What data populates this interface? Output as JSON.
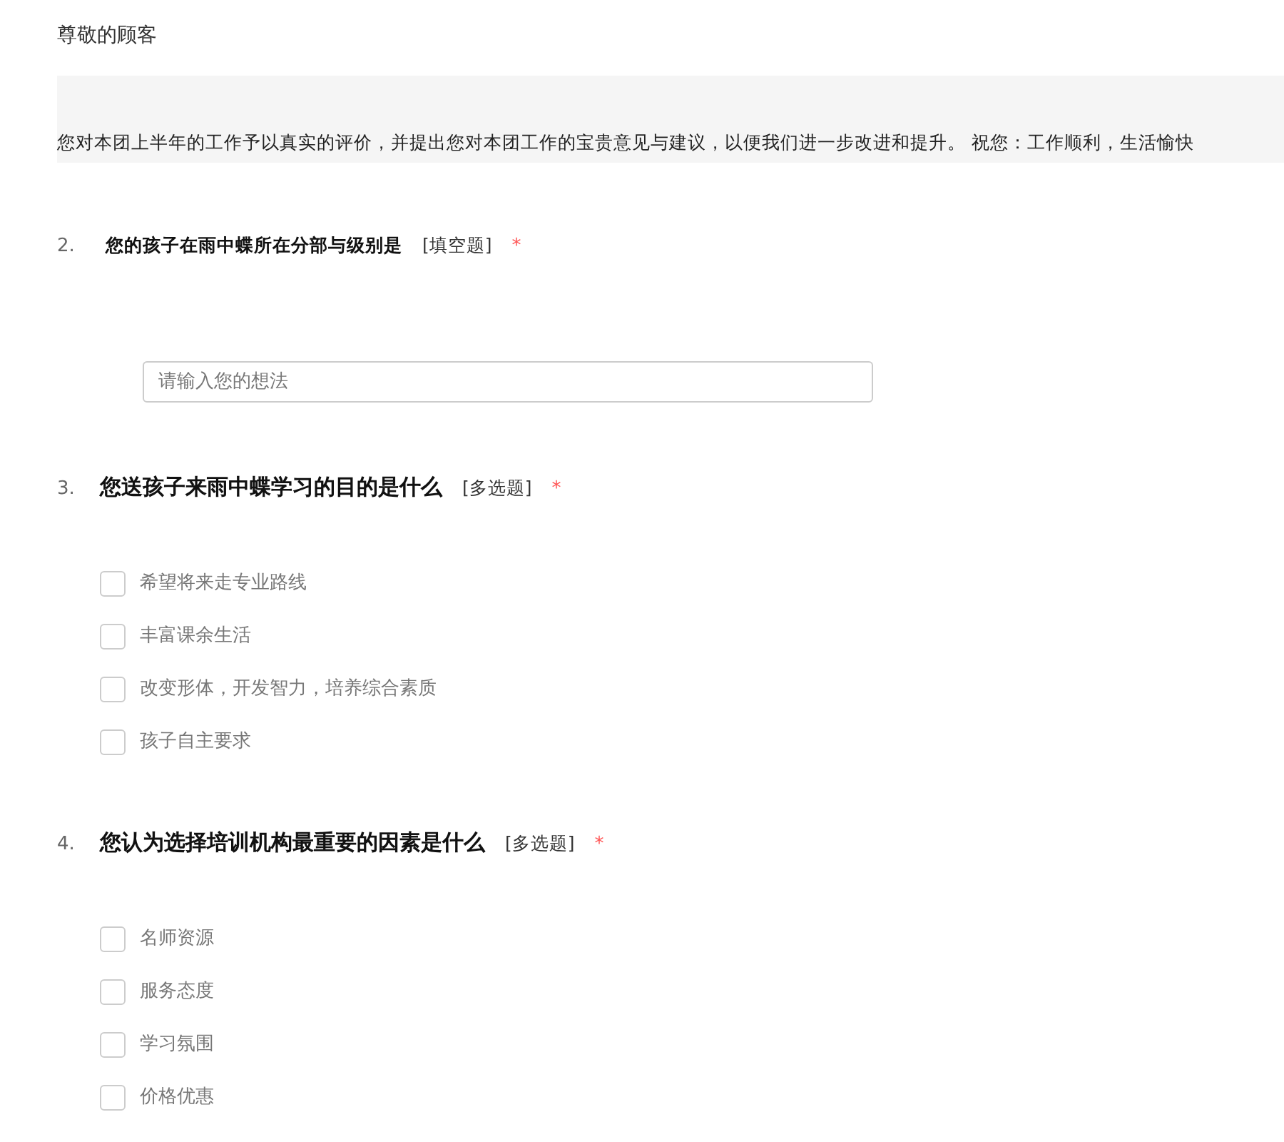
{
  "greeting": "尊敬的顾客",
  "intro": "您对本团上半年的工作予以真实的评价，并提出您对本团工作的宝贵意见与建议，以便我们进一步改进和提升。 祝您：工作顺利，生活愉快",
  "questions": [
    {
      "number": "2.",
      "kind": "text",
      "title": "您的孩子在雨中蝶所在分部与级别是",
      "type_label": "[填空题]",
      "required": true,
      "required_mark": "*",
      "placeholder": "请输入您的想法"
    },
    {
      "number": "3.",
      "kind": "multi",
      "title": "您送孩子来雨中蝶学习的目的是什么",
      "type_label": "[多选题]",
      "required": true,
      "required_mark": "*",
      "options": [
        {
          "label": "希望将来走专业路线",
          "checked": false
        },
        {
          "label": "丰富课余生活",
          "checked": false
        },
        {
          "label": "改变形体，开发智力，培养综合素质",
          "checked": false
        },
        {
          "label": "孩子自主要求",
          "checked": false
        }
      ]
    },
    {
      "number": "4.",
      "kind": "multi",
      "title": "您认为选择培训机构最重要的因素是什么",
      "type_label": "[多选题]",
      "required": true,
      "required_mark": "*",
      "options": [
        {
          "label": "名师资源",
          "checked": false
        },
        {
          "label": "服务态度",
          "checked": false
        },
        {
          "label": "学习氛围",
          "checked": false
        },
        {
          "label": "价格优惠",
          "checked": false
        }
      ]
    }
  ]
}
